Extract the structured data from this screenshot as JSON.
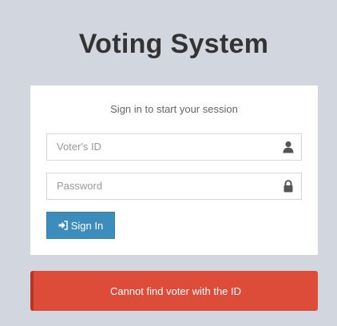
{
  "header": {
    "title": "Voting System"
  },
  "login": {
    "message": "Sign in to start your session",
    "voter_id": {
      "placeholder": "Voter's ID",
      "value": "",
      "icon": "user-icon"
    },
    "password": {
      "placeholder": "Password",
      "value": "",
      "icon": "lock-icon"
    },
    "signin_button": {
      "label": "Sign In",
      "icon": "sign-in-icon",
      "color": "#3c8dbc"
    }
  },
  "alert": {
    "text": "Cannot find voter with the ID",
    "color": "#dd4b39"
  },
  "colors": {
    "background": "#d2d6de",
    "box": "#ffffff"
  }
}
